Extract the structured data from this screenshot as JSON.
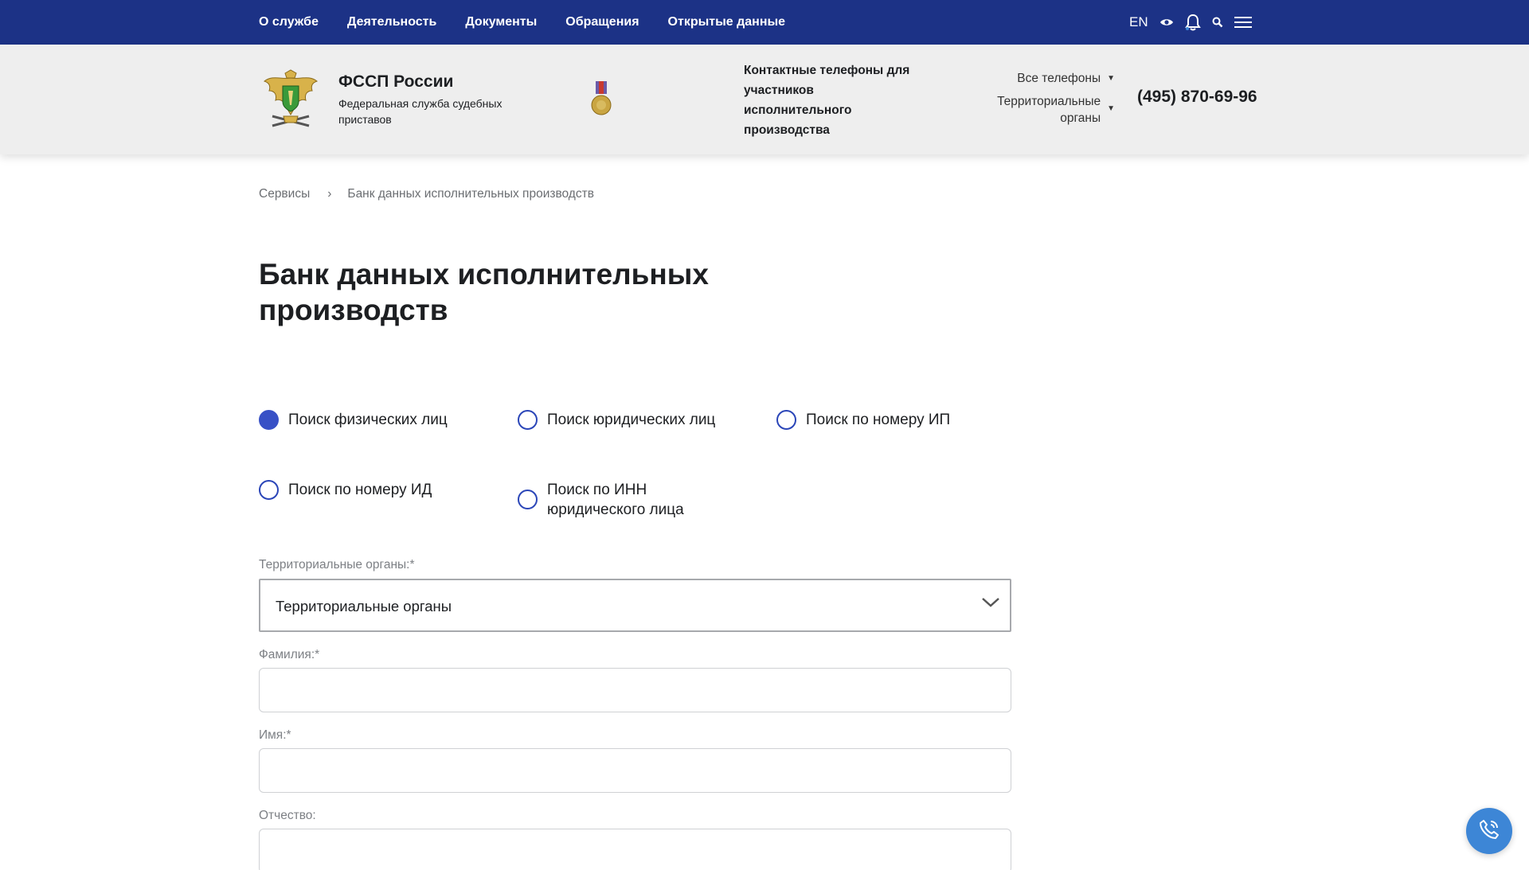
{
  "nav": {
    "items": [
      "О службе",
      "Деятельность",
      "Документы",
      "Обращения",
      "Открытые данные"
    ],
    "lang": "EN",
    "icons": [
      "eye-icon",
      "bell-icon",
      "search-icon",
      "menu-icon"
    ]
  },
  "header": {
    "org_name": "ФССП России",
    "org_subtitle": "Федеральная служба судебных приставов",
    "contacts_title": "Контактные телефоны для участников исполнительного производства",
    "all_phones": "Все телефоны",
    "territorial": "Территориальные органы",
    "phone": "(495) 870-69-96"
  },
  "breadcrumb": {
    "items": [
      "Сервисы",
      "Банк данных исполнительных производств"
    ],
    "separator": "›"
  },
  "page": {
    "title": "Банк данных исполнительных производств"
  },
  "search_modes": [
    {
      "label": "Поиск физических лиц",
      "checked": true
    },
    {
      "label": "Поиск юридических лиц",
      "checked": false
    },
    {
      "label": "Поиск по номеру ИП",
      "checked": false
    },
    {
      "label": "Поиск по номеру ИД",
      "checked": false
    },
    {
      "label": "Поиск по ИНН юридического лица",
      "checked": false
    }
  ],
  "form": {
    "territorial_label": "Территориальные органы:*",
    "territorial_value": "Территориальные органы",
    "lastname_label": "Фамилия:*",
    "lastname_value": "",
    "firstname_label": "Имя:*",
    "firstname_value": "",
    "patronymic_label": "Отчество:",
    "patronymic_value": ""
  },
  "colors": {
    "nav_bg": "#1c3286",
    "header_bg": "#eeeeee",
    "radio_accent": "#3851c6",
    "call_button": "#3d86d6"
  }
}
